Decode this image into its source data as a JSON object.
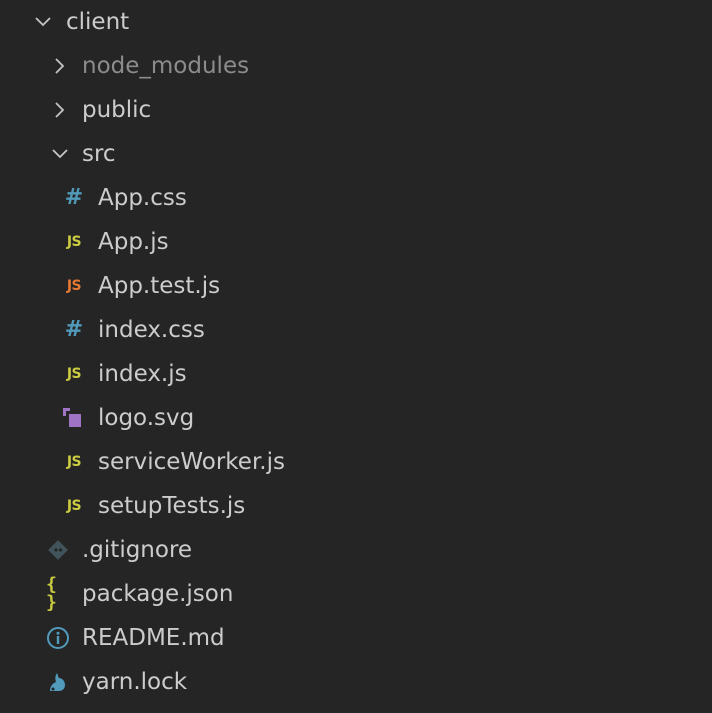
{
  "explorer": {
    "root": {
      "label": "client",
      "expanded": true
    },
    "folders": {
      "node_modules": {
        "label": "node_modules",
        "expanded": false
      },
      "public": {
        "label": "public",
        "expanded": false
      },
      "src": {
        "label": "src",
        "expanded": true
      }
    },
    "src_files": [
      {
        "label": "App.css",
        "icon": "css-file-icon"
      },
      {
        "label": "App.js",
        "icon": "javascript-file-icon"
      },
      {
        "label": "App.test.js",
        "icon": "javascript-test-file-icon"
      },
      {
        "label": "index.css",
        "icon": "css-file-icon"
      },
      {
        "label": "index.js",
        "icon": "javascript-file-icon"
      },
      {
        "label": "logo.svg",
        "icon": "svg-file-icon"
      },
      {
        "label": "serviceWorker.js",
        "icon": "javascript-file-icon"
      },
      {
        "label": "setupTests.js",
        "icon": "javascript-file-icon"
      }
    ],
    "root_files": [
      {
        "label": ".gitignore",
        "icon": "git-file-icon"
      },
      {
        "label": "package.json",
        "icon": "json-file-icon"
      },
      {
        "label": "README.md",
        "icon": "info-file-icon"
      },
      {
        "label": "yarn.lock",
        "icon": "yarn-file-icon"
      }
    ],
    "icon_glyphs": {
      "js": "JS",
      "css": "#",
      "json": "{ }"
    }
  },
  "colors": {
    "background": "#252526",
    "text": "#cccccc",
    "dimmed_text": "#8c8c8c",
    "chevron": "#c5c5c5",
    "js_icon": "#cbcb41",
    "test_js_icon": "#e37933",
    "css_icon": "#519aba",
    "svg_icon": "#a074c4",
    "git_icon": "#41535b",
    "json_icon": "#cbcb41",
    "info_icon": "#519aba",
    "yarn_icon": "#519aba"
  }
}
